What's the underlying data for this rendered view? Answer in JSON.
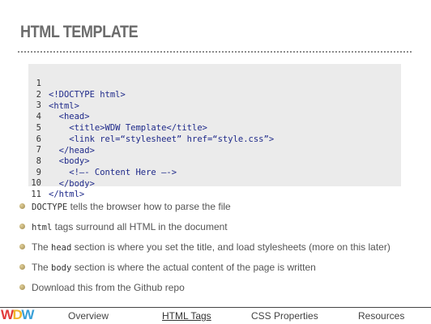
{
  "slide": {
    "title": "HTML TEMPLATE"
  },
  "code": {
    "lines": [
      {
        "num": "1",
        "text": "<!DOCTYPE html>"
      },
      {
        "num": "2",
        "text": "<html>"
      },
      {
        "num": "3",
        "text": "  <head>"
      },
      {
        "num": "4",
        "text": "    <title>WDW Template</title>"
      },
      {
        "num": "5",
        "text": "    <link rel=“stylesheet” href=“style.css”>"
      },
      {
        "num": "6",
        "text": "  </head>"
      },
      {
        "num": "7",
        "text": "  <body>"
      },
      {
        "num": "8",
        "text": "    <!—- Content Here —->"
      },
      {
        "num": "9",
        "text": "  </body>"
      },
      {
        "num": "10",
        "text": "</html>"
      },
      {
        "num": "11",
        "text": ""
      }
    ]
  },
  "bullets": [
    {
      "code": "DOCTYPE",
      "pre": "",
      "post": " tells the browser how to parse the file"
    },
    {
      "code": "html",
      "pre": "",
      "post": " tags surround all HTML in the document"
    },
    {
      "code": "head",
      "pre": "The ",
      "post": " section is where you set the title, and load stylesheets (more on this later)"
    },
    {
      "code": "body",
      "pre": "The ",
      "post": " section is where the actual content of the page is written"
    },
    {
      "code": "",
      "pre": "Download this from the Github repo",
      "post": ""
    }
  ],
  "footer": {
    "logo": {
      "w1": "W",
      "d": "D",
      "w2": "W"
    },
    "nav": [
      {
        "label": "Overview",
        "active": false
      },
      {
        "label": "HTML Tags",
        "active": true
      },
      {
        "label": "CSS Properties",
        "active": false
      },
      {
        "label": "Resources",
        "active": false
      }
    ]
  },
  "colors": {
    "title": "#6b6b6b",
    "code_text": "#1f2a8a",
    "code_background": "#ebebeb",
    "body_text": "#555555",
    "logo_red": "#e23a3a",
    "logo_yellow": "#f0b52b",
    "logo_blue": "#3aa0d8"
  }
}
